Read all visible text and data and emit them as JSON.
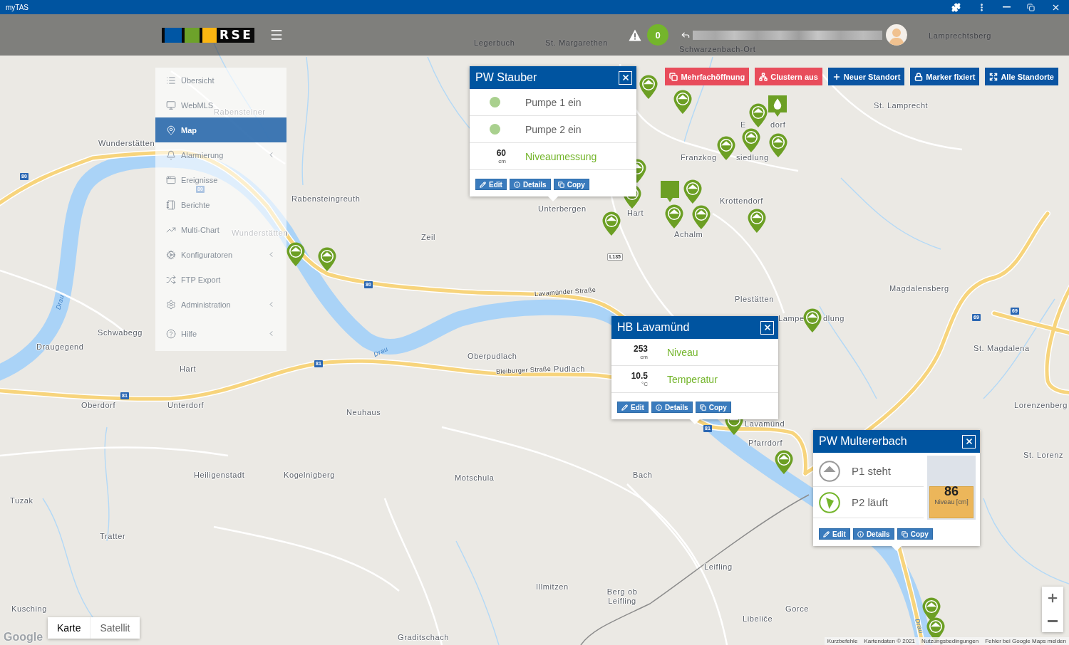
{
  "window": {
    "title": "myTAS"
  },
  "header": {
    "logo_text": "RSE",
    "alert_count": "0"
  },
  "toolbar": [
    {
      "label": "Mehrfachöffnung",
      "kind": "multi",
      "color": "#e84c5b"
    },
    {
      "label": "Clustern aus",
      "kind": "cluster",
      "color": "#e84c5b"
    },
    {
      "label": "Neuer Standort",
      "kind": "add",
      "color": "#0a54a2"
    },
    {
      "label": "Marker fixiert",
      "kind": "lock",
      "color": "#0a54a2"
    },
    {
      "label": "Alle Standorte",
      "kind": "fit",
      "color": "#0a54a2"
    }
  ],
  "sidebar": {
    "items": [
      {
        "label": "Übersicht",
        "kind": "link",
        "selected": false
      },
      {
        "label": "WebMLS",
        "kind": "link",
        "selected": false
      },
      {
        "label": "Map",
        "kind": "link",
        "selected": true
      },
      {
        "label": "Alarmierung",
        "kind": "group",
        "selected": false
      },
      {
        "label": "Ereignisse",
        "kind": "link",
        "selected": false
      },
      {
        "label": "Berichte",
        "kind": "link",
        "selected": false
      },
      {
        "label": "Multi-Chart",
        "kind": "link",
        "selected": false
      },
      {
        "label": "Konfiguratoren",
        "kind": "group",
        "selected": false
      },
      {
        "label": "FTP Export",
        "kind": "link",
        "selected": false
      },
      {
        "label": "Administration",
        "kind": "group",
        "selected": false
      },
      {
        "label": "Hilfe",
        "kind": "group",
        "selected": false
      }
    ]
  },
  "map": {
    "place_labels": [
      "Lamprechtsberg",
      "Legerbuch",
      "St. Margarethen",
      "Schwarzenbach-Ort",
      "St. Lamprecht",
      "Rabensteiner",
      "E",
      "dorf",
      "Wunderstätten",
      "Franzkog",
      "siedlung",
      "Rabensteingreuth",
      "Krottendorf",
      "Unterbergen",
      "Hart",
      "Wunderstätten",
      "Zeil",
      "Achalm",
      "Magdalensberg",
      "Plestätten",
      "Lampe",
      "dlung",
      "Schwabegg",
      "Draugegend",
      "St. Magdalena",
      "Oberpudlach",
      "Hart",
      "Pudlach",
      "Oberdorf",
      "Unterdorf",
      "Lorenzenberg",
      "Neuhaus",
      "Lavamünd",
      "Pfarrdorf",
      "St. Lorenz",
      "Heiligenstadt",
      "Kogelnigberg",
      "Motschula",
      "Bach",
      "Tuzak",
      "Tratter",
      "Leifling",
      "Illmitzen",
      "Berg ob Leifling",
      "Kusching",
      "Gorce",
      "Libeliče",
      "Graditschach"
    ],
    "street_labels": [
      "Lavamünder Straße",
      "Bleiburger Straße"
    ],
    "river_labels": [
      "Drau",
      "Drau",
      "Drau"
    ],
    "route_shields": [
      {
        "text": "80",
        "kind": "federal"
      },
      {
        "text": "80",
        "kind": "federal"
      },
      {
        "text": "L135",
        "kind": "state"
      },
      {
        "text": "80",
        "kind": "federal"
      },
      {
        "text": "69",
        "kind": "federal"
      },
      {
        "text": "69",
        "kind": "federal"
      },
      {
        "text": "81",
        "kind": "federal"
      },
      {
        "text": "81",
        "kind": "federal"
      },
      {
        "text": "81",
        "kind": "federal"
      }
    ],
    "map_types": [
      {
        "label": "Karte",
        "selected": true
      },
      {
        "label": "Satellit",
        "selected": false
      }
    ],
    "logo_text": "Google",
    "attribution": [
      "Kurzbefehle",
      "Kartendaten © 2021",
      "Nutzungsbedingungen",
      "Fehler bei Google Maps melden"
    ]
  },
  "popups": [
    {
      "title": "PW Stauber",
      "rows": [
        {
          "kind": "status",
          "label": "Pumpe 1 ein",
          "on": true
        },
        {
          "kind": "status",
          "label": "Pumpe 2 ein",
          "on": true
        },
        {
          "kind": "measure",
          "value": "60",
          "unit": "cm",
          "label": "Niveaumessung"
        }
      ],
      "buttons": [
        {
          "kind": "edit",
          "label": "Edit"
        },
        {
          "kind": "details",
          "label": "Details"
        },
        {
          "kind": "copy",
          "label": "Copy"
        }
      ]
    },
    {
      "title": "HB Lavamünd",
      "rows": [
        {
          "kind": "measure",
          "value": "253",
          "unit": "cm",
          "label": "Niveau"
        },
        {
          "kind": "measure",
          "value": "10.5",
          "unit": "°C",
          "label": "Temperatur"
        }
      ],
      "buttons": [
        {
          "kind": "edit",
          "label": "Edit"
        },
        {
          "kind": "details",
          "label": "Details"
        },
        {
          "kind": "copy",
          "label": "Copy"
        }
      ]
    },
    {
      "title": "PW Multererbach",
      "rows": [
        {
          "kind": "pump",
          "label": "P1 steht",
          "running": false
        },
        {
          "kind": "pump",
          "label": "P2 läuft",
          "running": true
        }
      ],
      "gauge": {
        "value": "86",
        "label": "Niveau [cm]",
        "level": 0.5
      },
      "buttons": [
        {
          "kind": "edit",
          "label": "Edit"
        },
        {
          "kind": "details",
          "label": "Details"
        },
        {
          "kind": "copy",
          "label": "Copy"
        }
      ]
    }
  ]
}
